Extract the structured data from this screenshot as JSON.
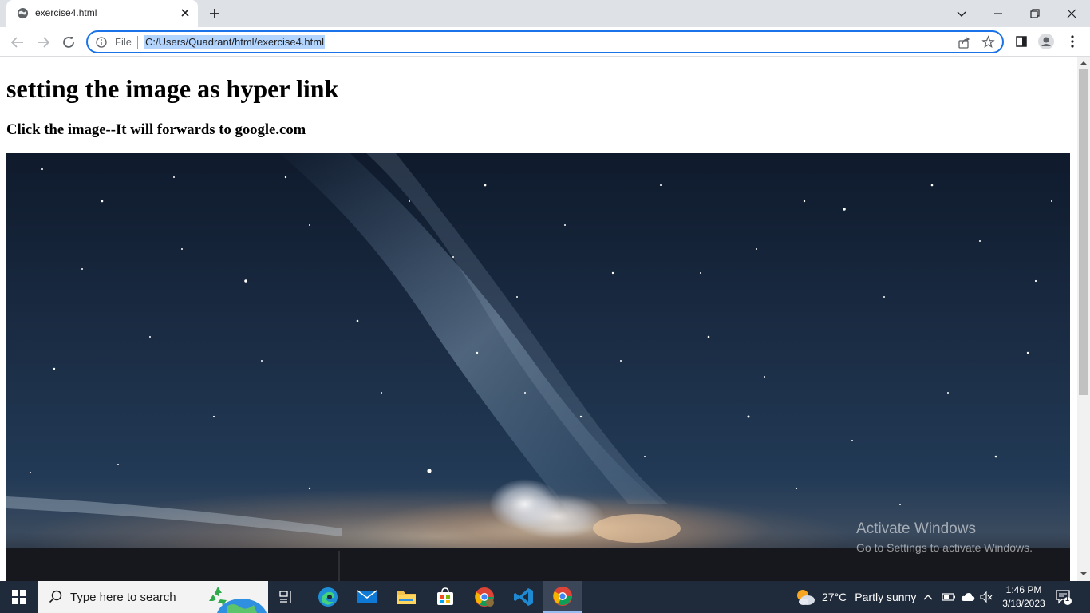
{
  "browser": {
    "tab_title": "exercise4.html",
    "address_scheme": "File",
    "address_url": "C:/Users/Quadrant/html/exercise4.html"
  },
  "page": {
    "heading": "setting the image as hyper link",
    "subheading": "Click the image--It will forwards to google.com",
    "image_link_target": "google.com"
  },
  "watermark": {
    "line1": "Activate Windows",
    "line2": "Go to Settings to activate Windows."
  },
  "taskbar": {
    "search_placeholder": "Type here to search",
    "weather_temp": "27°C",
    "weather_desc": "Partly sunny",
    "time": "1:46 PM",
    "date": "3/18/2023",
    "notification_count": "1"
  },
  "colors": {
    "accent": "#1a73e8",
    "taskbar": "#1f2a3a",
    "tabstrip": "#dee1e6"
  }
}
